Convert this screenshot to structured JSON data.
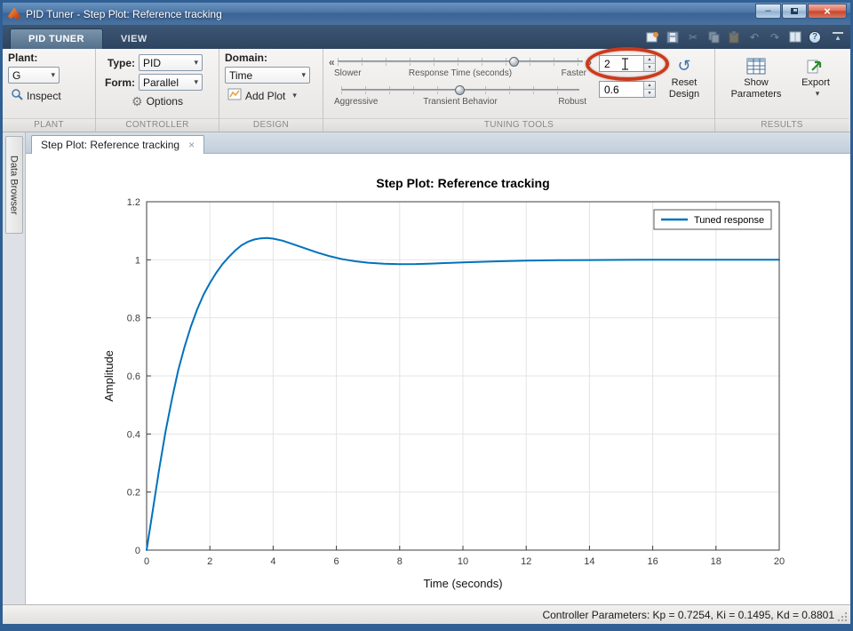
{
  "glyphs": {
    "caret": "▾",
    "chevron_left": "«",
    "chevron_right": "»",
    "spin_up": "▲",
    "spin_down": "▼",
    "minimize": "–",
    "close": "×",
    "tab_close": "×",
    "cut": "✂",
    "undo": "↶",
    "redo": "↷",
    "gear": "⚙",
    "help": "?",
    "reset": "↺",
    "collapse": "▴"
  },
  "window": {
    "title": "PID Tuner - Step Plot: Reference tracking"
  },
  "toolstrip": {
    "tabs": [
      {
        "label": "PID TUNER"
      },
      {
        "label": "VIEW"
      }
    ],
    "sections": {
      "plant": {
        "label": "PLANT",
        "field_label": "Plant:",
        "value": "G",
        "inspect_label": "Inspect"
      },
      "controller": {
        "label": "CONTROLLER",
        "type_label": "Type:",
        "type_value": "PID",
        "form_label": "Form:",
        "form_value": "Parallel",
        "options_label": "Options"
      },
      "design": {
        "label": "DESIGN",
        "domain_label": "Domain:",
        "domain_value": "Time",
        "add_plot_label": "Add Plot"
      },
      "tuning": {
        "label": "TUNING TOOLS",
        "slider1": {
          "left_label": "Slower",
          "center_label": "Response Time (seconds)",
          "right_label": "Faster",
          "value_percent": 72
        },
        "slider2": {
          "left_label": "Aggressive",
          "center_label": "Transient Behavior",
          "right_label": "Robust",
          "value_percent": 50
        },
        "response_time_value": "2",
        "transient_behavior_value": "0.6",
        "reset_label": "Reset Design"
      },
      "results": {
        "label": "RESULTS",
        "show_parameters_label": "Show Parameters",
        "export_label": "Export"
      }
    }
  },
  "sidebar": {
    "label": "Data Browser"
  },
  "document": {
    "tab_label": "Step Plot: Reference tracking"
  },
  "statusbar": {
    "text": "Controller Parameters: Kp = 0.7254, Ki = 0.1495, Kd = 0.8801"
  },
  "chart_data": {
    "type": "line",
    "title": "Step Plot: Reference tracking",
    "xlabel": "Time (seconds)",
    "ylabel": "Amplitude",
    "xlim": [
      0,
      20
    ],
    "ylim": [
      0,
      1.2
    ],
    "xticks": [
      0,
      2,
      4,
      6,
      8,
      10,
      12,
      14,
      16,
      18,
      20
    ],
    "yticks": [
      0,
      0.2,
      0.4,
      0.6,
      0.8,
      1,
      1.2
    ],
    "grid": true,
    "legend": {
      "position": "top-right",
      "entries": [
        "Tuned response"
      ]
    },
    "series": [
      {
        "name": "Tuned response",
        "color": "#0072bd",
        "x": [
          0,
          0.2,
          0.4,
          0.6,
          0.8,
          1,
          1.2,
          1.4,
          1.6,
          1.8,
          2,
          2.2,
          2.4,
          2.6,
          2.8,
          3,
          3.2,
          3.4,
          3.6,
          3.8,
          4,
          4.3,
          4.6,
          5,
          5.4,
          5.8,
          6.2,
          6.6,
          7,
          7.5,
          8,
          8.5,
          9,
          9.5,
          10,
          11,
          12,
          13,
          14,
          15,
          16,
          17,
          18,
          19,
          20
        ],
        "y": [
          0,
          0.14,
          0.28,
          0.41,
          0.52,
          0.62,
          0.7,
          0.77,
          0.83,
          0.88,
          0.92,
          0.955,
          0.985,
          1.01,
          1.032,
          1.05,
          1.062,
          1.07,
          1.074,
          1.075,
          1.073,
          1.066,
          1.055,
          1.04,
          1.025,
          1.012,
          1.002,
          0.995,
          0.99,
          0.9865,
          0.985,
          0.9855,
          0.987,
          0.989,
          0.991,
          0.9945,
          0.997,
          0.9985,
          0.9993,
          0.9997,
          1,
          1,
          1,
          1,
          1
        ]
      }
    ]
  }
}
